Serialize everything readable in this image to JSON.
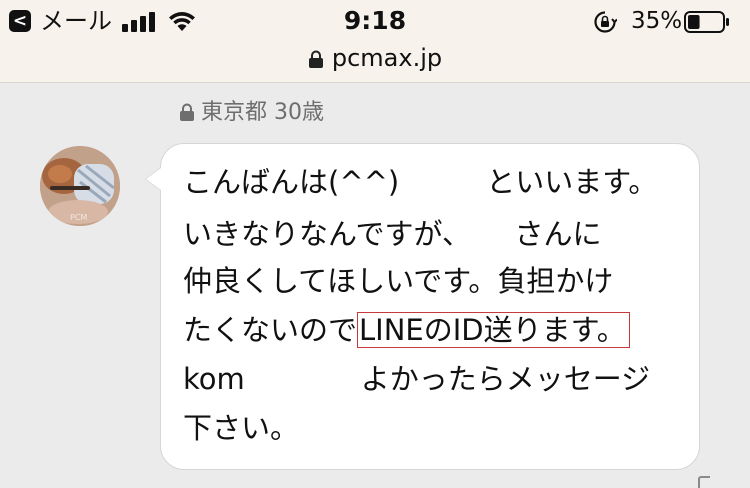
{
  "status_bar": {
    "back_badge": "<",
    "back_app": "メール",
    "time": "9:18",
    "battery_percent": "35%",
    "battery_level": 0.35,
    "signal_bars": 4,
    "icons": [
      "back-icon",
      "signal-icon",
      "wifi-icon",
      "rotation-lock-icon",
      "battery-icon"
    ]
  },
  "address_bar": {
    "url": "pcmax.jp",
    "icon": "lock-icon"
  },
  "message": {
    "sender_info": "東京都 30歳",
    "sender_info_icon": "lock-icon",
    "lines": {
      "l1": "こんばんは(^^)　　　といいます。",
      "l2": "いきなりなんですが、　　さんに",
      "l3": "仲良くしてほしいです。負担かけ",
      "l4_before": "たくないので",
      "l4_highlight": "LINEのID送ります。",
      "l5": "kom　　　　よかったらメッセージ",
      "l6": "下さい。"
    },
    "highlight_color": "#c83a3a"
  }
}
